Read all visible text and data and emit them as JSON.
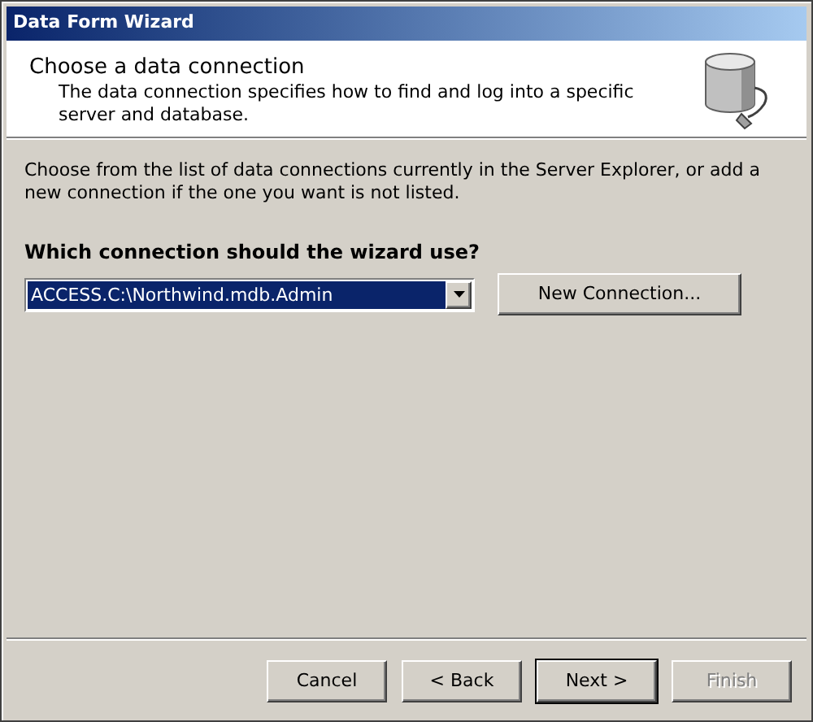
{
  "window": {
    "title": "Data Form Wizard"
  },
  "header": {
    "title": "Choose a data connection",
    "description": "The data connection specifies how to find and log into a specific server and database."
  },
  "instructions": "Choose from the list of data connections currently in the Server Explorer, or add a new connection if the one you want is not listed.",
  "connection": {
    "label": "Which connection should the wizard use?",
    "value": "ACCESS.C:\\Northwind.mdb.Admin",
    "button": "New Connection..."
  },
  "buttons": [
    {
      "label": "Cancel",
      "default": false,
      "disabled": false
    },
    {
      "label": "< Back",
      "default": false,
      "disabled": false
    },
    {
      "label": "Next >",
      "default": true,
      "disabled": false
    },
    {
      "label": "Finish",
      "default": false,
      "disabled": true
    }
  ]
}
